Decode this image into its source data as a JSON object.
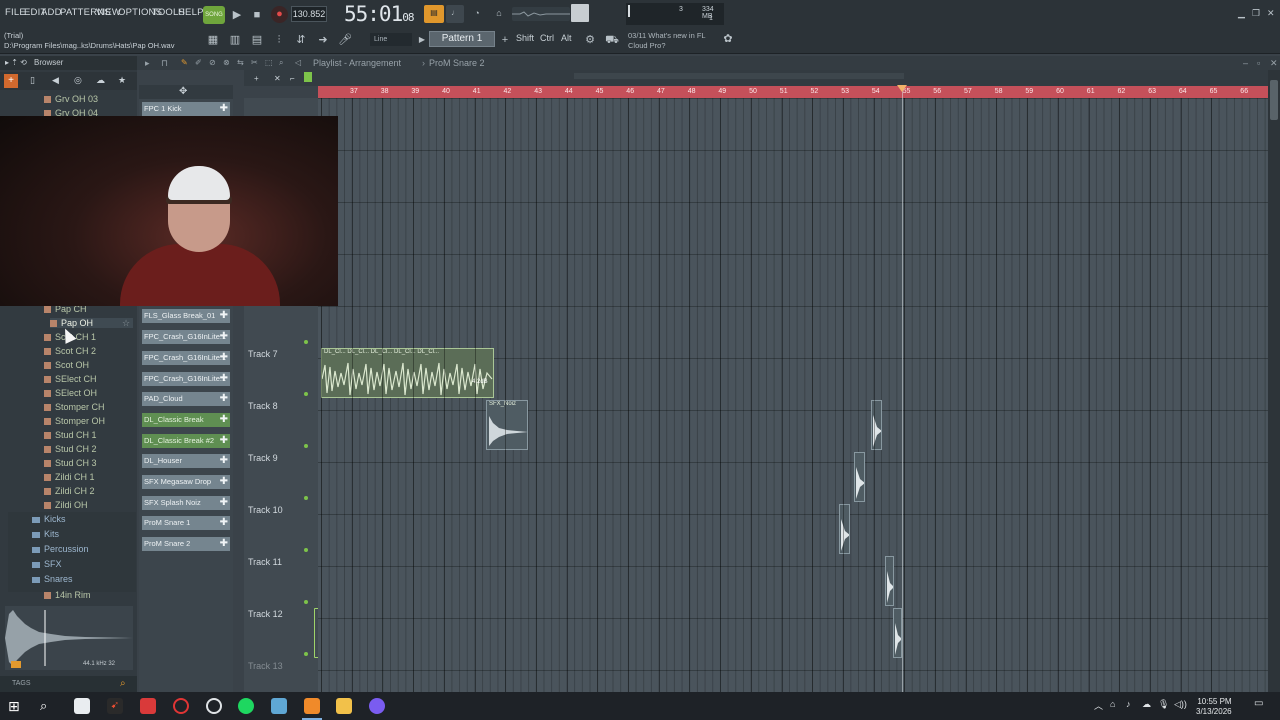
{
  "menu": [
    "FILE",
    "EDIT",
    "ADD",
    "PATTERNS",
    "VIEW",
    "OPTIONS",
    "TOOLS",
    "HELP"
  ],
  "window": {
    "trial_label": "(Trial)",
    "file_path": "D:\\Program Files\\mag..ks\\Drums\\Hats\\Pap OH.wav"
  },
  "transport": {
    "song_label": "SONG",
    "tempo": "130.852",
    "time_main": "55:01",
    "time_sub": "08",
    "cpu_num": "3",
    "memory": "334 MB",
    "voices": "1"
  },
  "toolbar": {
    "snap": "Line",
    "pattern": "Pattern 1",
    "shift": "Shift",
    "ctrl": "Ctrl",
    "alt": "Alt",
    "news_line1": "03/11  What's new in FL",
    "news_line2": "Cloud Pro?"
  },
  "browser": {
    "title": "Browser",
    "items_top": [
      "Grv OH 03",
      "Grv OH 04"
    ],
    "items": [
      "Pap CH",
      "Pap OH",
      "Scot CH 1",
      "Scot CH 2",
      "Scot OH",
      "SElect CH",
      "SElect OH",
      "Stomper CH",
      "Stomper OH",
      "Stud CH 1",
      "Stud CH 2",
      "Stud CH 3",
      "Zildi CH 1",
      "Zildi CH 2",
      "Zildi OH"
    ],
    "folders": [
      "Kicks",
      "Kits",
      "Percussion",
      "SFX",
      "Snares"
    ],
    "sub_item": "14in Rim",
    "sample_info": "44.1 kHz 32",
    "tags": "TAGS"
  },
  "channels": [
    "FPC 1 Kick",
    "FLS_Glass Break_01",
    "FPC_Crash_G16InLite...",
    "FPC_Crash_G16InLite...",
    "FPC_Crash_G16InLite...",
    "PAD_Cloud",
    "DL_Classic Break",
    "DL_Classic Break #2",
    "DL_Houser",
    "SFX Megasaw Drop",
    "SFX Splash Noiz",
    "ProM Snare 1",
    "ProM Snare 2"
  ],
  "playlist": {
    "title": "Playlist - Arrangement",
    "current": "ProM Snare 2",
    "ruler": [
      "37",
      "38",
      "39",
      "40",
      "41",
      "42",
      "43",
      "44",
      "45",
      "46",
      "47",
      "48",
      "49",
      "50",
      "51",
      "52",
      "53",
      "54",
      "55",
      "56",
      "57",
      "58",
      "59",
      "60",
      "61",
      "62",
      "63",
      "64",
      "65",
      "66"
    ],
    "tracks": [
      "Track 7",
      "Track 8",
      "Track 9",
      "Track 10",
      "Track 11",
      "Track 12",
      "Track 13"
    ],
    "clip_break_label": "DL_Cl... DL_Cl... DL_Cl... DL_Cl... DL_Cl...",
    "clip_gain": "4.2dB",
    "clip_sfx_label": "SFX_Noiz"
  },
  "taskbar": {
    "time": "10:55 PM",
    "date": "3/13/2026"
  },
  "colors": {
    "accent_green": "#6fa53c",
    "ruler_red": "#c5505a",
    "playlist_bg": "#4a545c"
  }
}
